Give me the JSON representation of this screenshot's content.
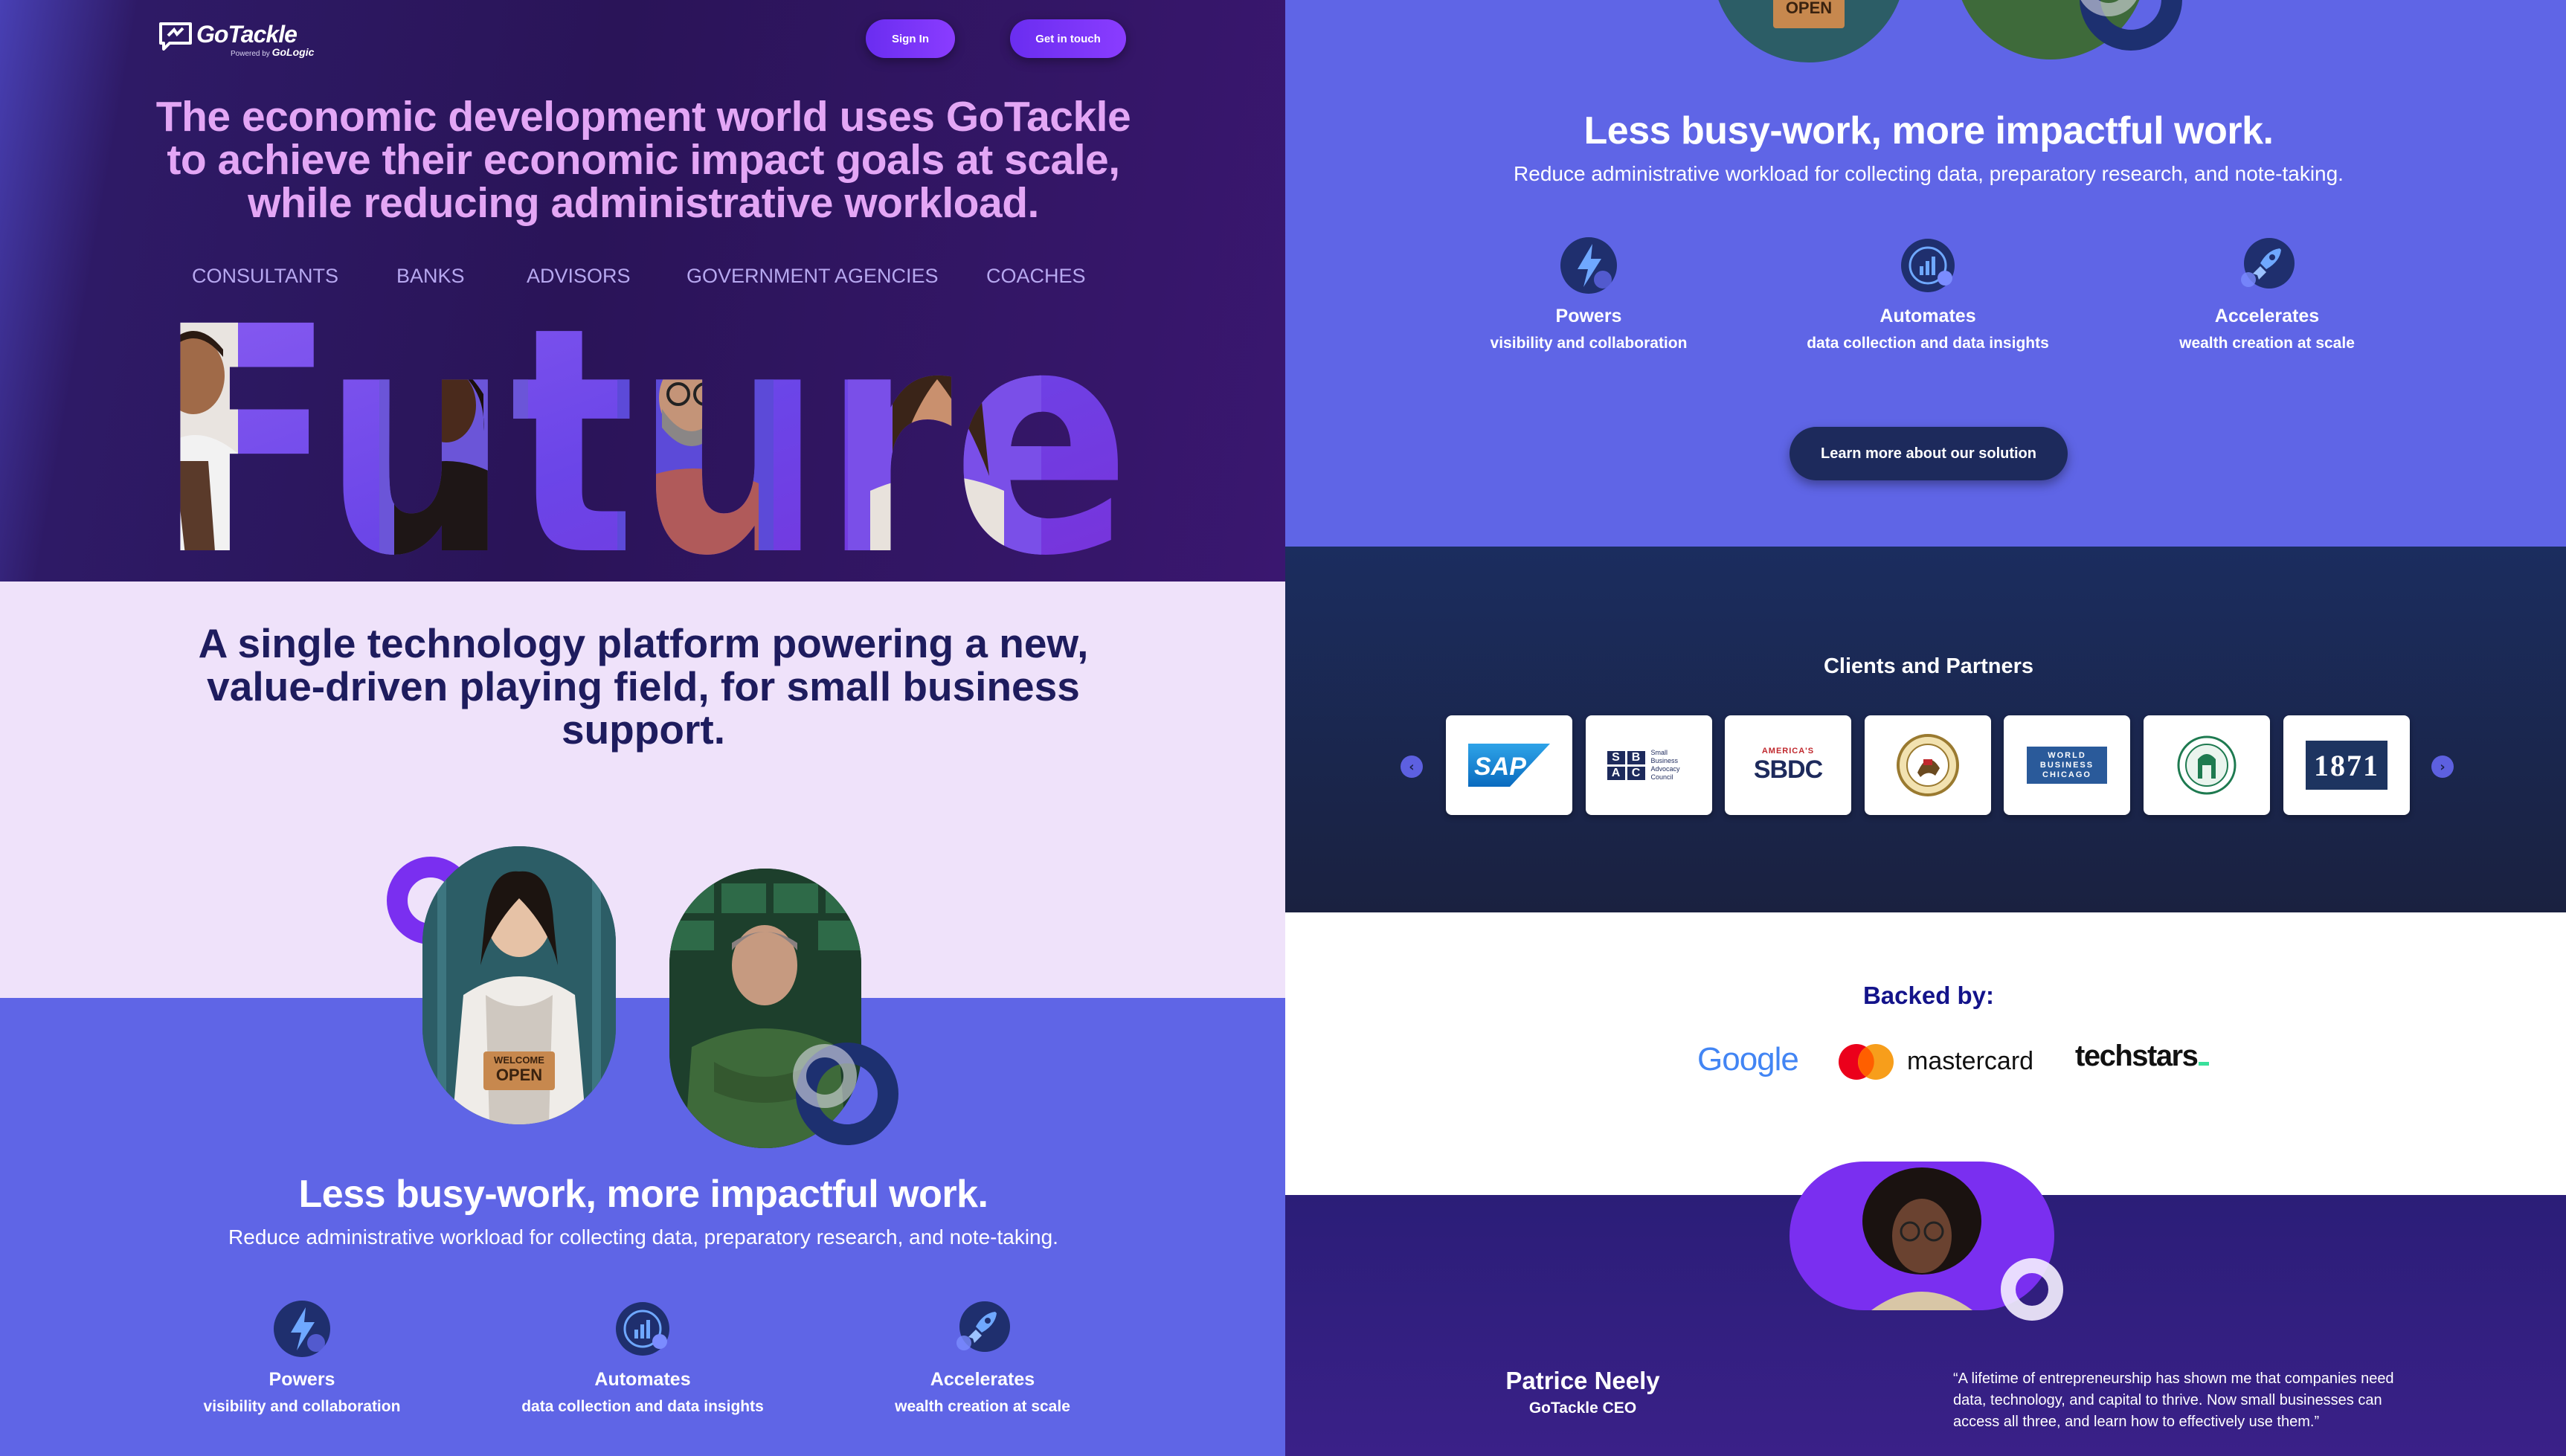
{
  "header": {
    "logo_word": "GoTackle",
    "logo_byline": "Powered by",
    "logo_parent": "GoLogic",
    "signin_label": "Sign In",
    "contact_label": "Get in touch"
  },
  "hero": {
    "title": "The economic development world uses GoTackle to achieve their economic impact goals at scale, while reducing administrative workload.",
    "audiences": [
      "CONSULTANTS",
      "BANKS",
      "ADVISORS",
      "GOVERNMENT AGENCIES",
      "COACHES"
    ],
    "banner_word": "Future"
  },
  "platform": {
    "title": "A single technology platform powering a new, value-driven playing field, for small business support."
  },
  "impact": {
    "title": "Less busy-work, more impactful work.",
    "subtitle": "Reduce administrative workload for collecting data, preparatory research, and note-taking.",
    "sign_text_top": "WELCOME",
    "sign_text_bottom": "OPEN",
    "features": [
      {
        "icon": "lightning-icon",
        "title": "Powers",
        "sub": "visibility and collaboration"
      },
      {
        "icon": "chart-icon",
        "title": "Automates",
        "sub": "data collection and data insights"
      },
      {
        "icon": "rocket-icon",
        "title": "Accelerates",
        "sub": "wealth creation at scale"
      }
    ],
    "cta_label": "Learn more about our solution"
  },
  "clients": {
    "title": "Clients and Partners",
    "prev": "‹",
    "next": "›",
    "logos": [
      {
        "name": "sap-logo",
        "text": "SAP"
      },
      {
        "name": "sbac-logo",
        "text": "Small Business Advocacy Council",
        "letters": [
          "S",
          "B",
          "A",
          "C"
        ]
      },
      {
        "name": "sbdc-logo",
        "text": "SBDC",
        "pre": "AMERICA'S"
      },
      {
        "name": "illinois-seal-logo",
        "text": ""
      },
      {
        "name": "world-business-chicago-logo",
        "text": "WORLD BUSINESS CHICAGO"
      },
      {
        "name": "green-seal-logo",
        "text": ""
      },
      {
        "name": "1871-logo",
        "text": "1871"
      }
    ]
  },
  "backed": {
    "title": "Backed by:",
    "google": "Google",
    "mastercard": "mastercard",
    "techstars": "techstars"
  },
  "ceo": {
    "name": "Patrice Neely",
    "role": "GoTackle CEO",
    "quote": "“A lifetime of entrepreneurship has shown me that companies need data, technology, and capital to thrive. Now small businesses can access all three, and learn how to effectively use them.”"
  },
  "colors": {
    "hero_bg": "#2a1458",
    "title_pink": "#e3a6f5",
    "lavender": "#efe2fa",
    "periwinkle": "#5f65e6",
    "navy": "#1d2a5c",
    "accent_purple": "#7a2ff0"
  }
}
